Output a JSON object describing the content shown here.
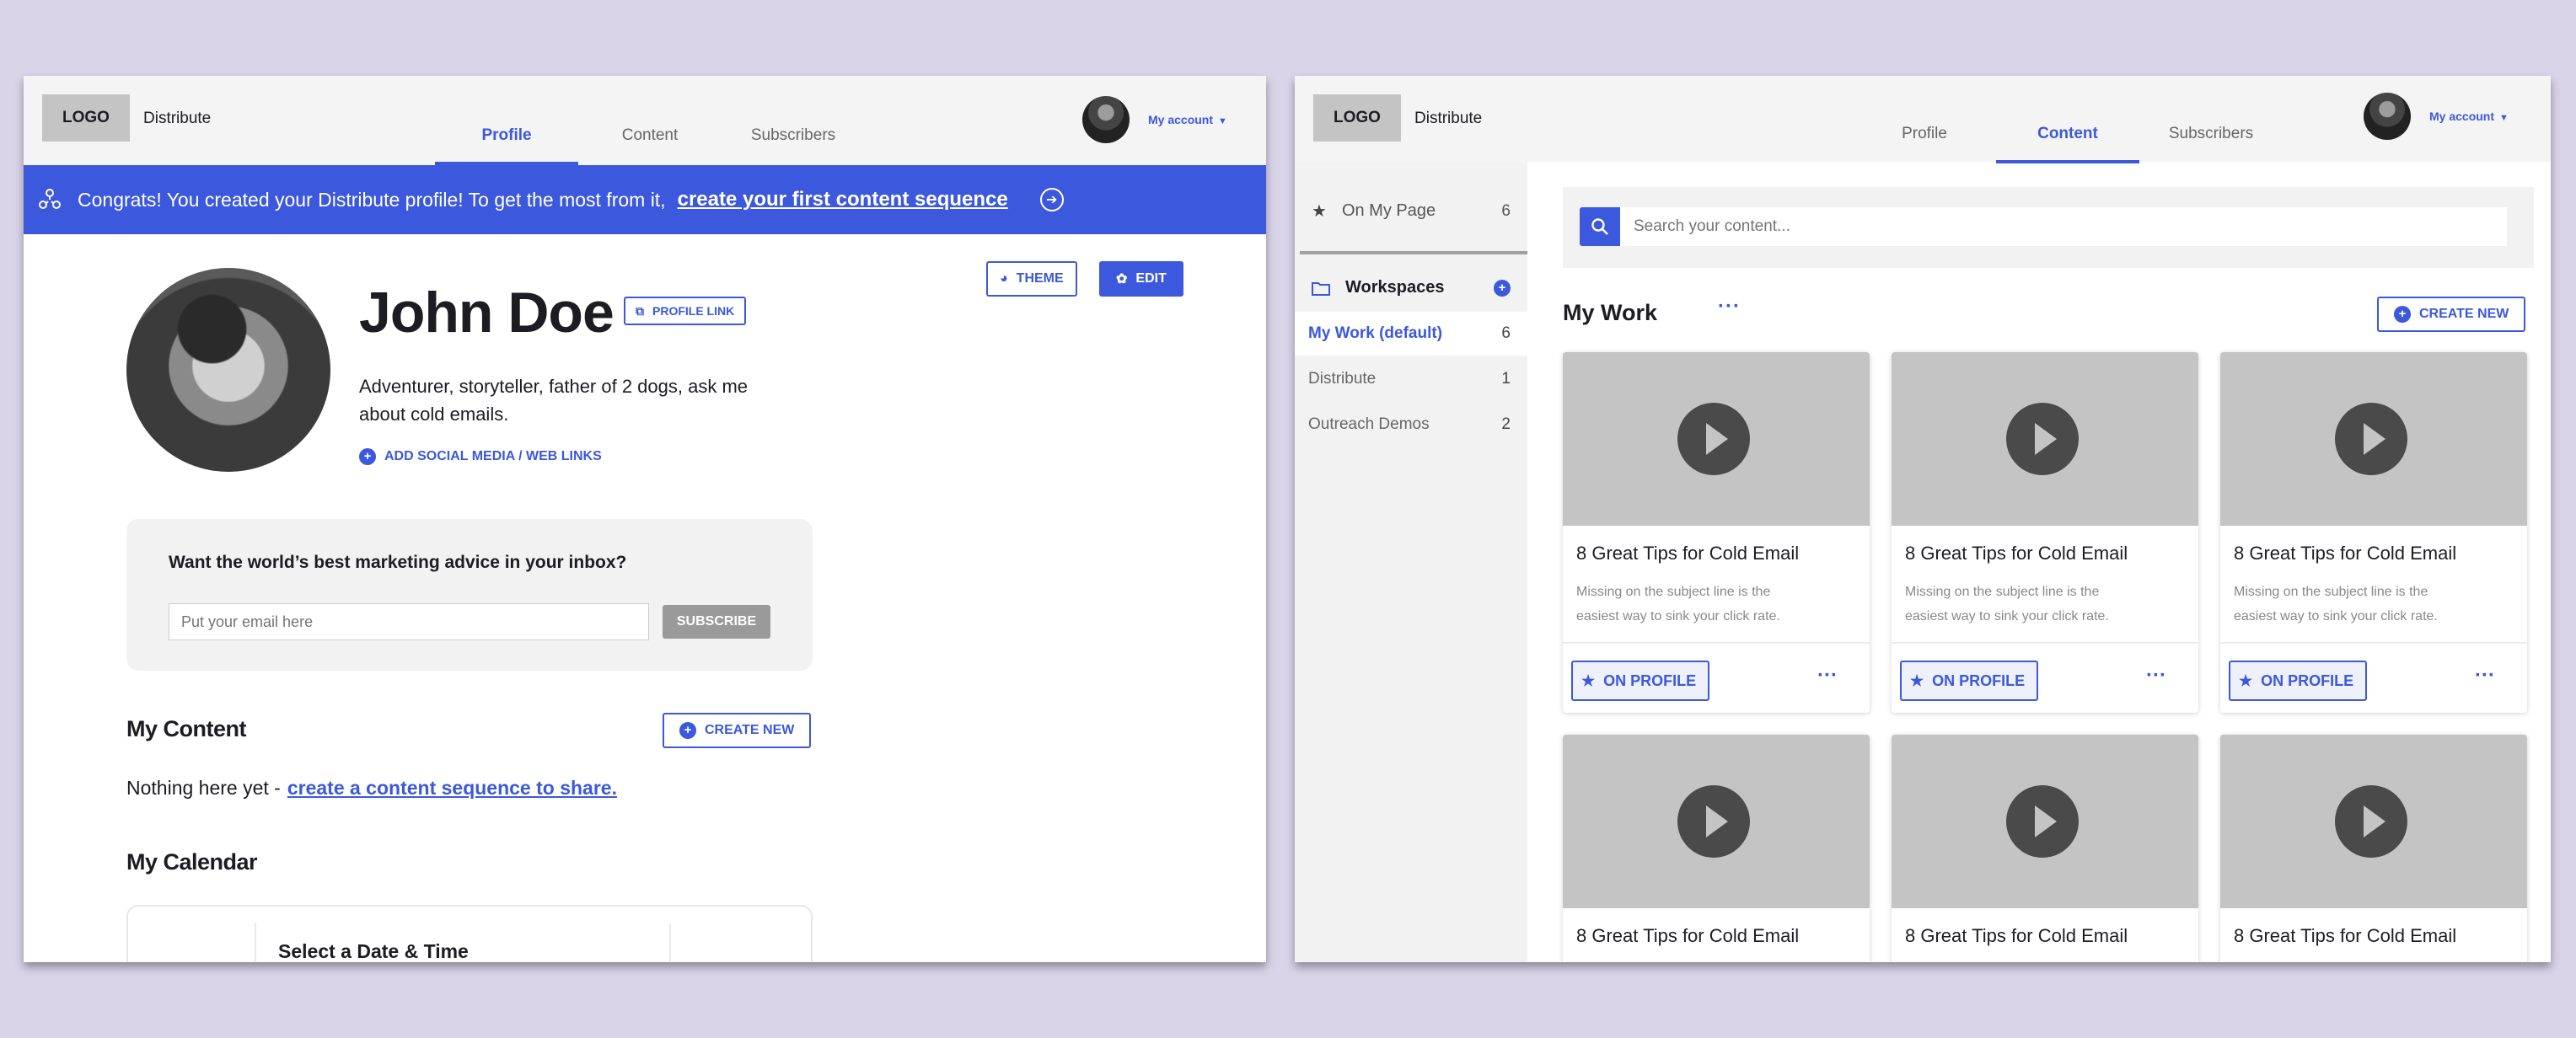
{
  "left_window": {
    "logo": "LOGO",
    "brand": "Distribute",
    "tabs": [
      {
        "label": "Profile"
      },
      {
        "label": "Content"
      },
      {
        "label": "Subscribers"
      }
    ],
    "account_label": "My account",
    "banner": {
      "text": "Congrats! You created your Distribute profile! To get the most from it,",
      "link": "create your first content sequence"
    },
    "profile": {
      "name": "John Doe",
      "profile_link_label": "PROFILE LINK",
      "theme_label": "THEME",
      "edit_label": "EDIT",
      "bio": "Adventurer, storyteller, father of 2 dogs, ask me about cold emails.",
      "add_links_label": "ADD SOCIAL MEDIA / WEB LINKS"
    },
    "newsletter": {
      "heading": "Want the world’s best marketing advice in your inbox?",
      "email_placeholder": "Put your email here",
      "subscribe_label": "SUBSCRIBE"
    },
    "my_content": {
      "heading": "My Content",
      "create_label": "CREATE NEW",
      "empty_text": "Nothing here yet -",
      "empty_link": "create a content sequence to share."
    },
    "my_calendar": {
      "heading": "My Calendar",
      "widget_title": "Select a Date & Time"
    }
  },
  "right_window": {
    "logo": "LOGO",
    "brand": "Distribute",
    "tabs": [
      {
        "label": "Profile"
      },
      {
        "label": "Content"
      },
      {
        "label": "Subscribers"
      }
    ],
    "account_label": "My account",
    "sidebar": {
      "on_my_page": {
        "label": "On My Page",
        "count": "6"
      },
      "workspaces_label": "Workspaces",
      "workspaces": [
        {
          "label": "My Work (default)",
          "count": "6"
        },
        {
          "label": "Distribute",
          "count": "1"
        },
        {
          "label": "Outreach Demos",
          "count": "2"
        }
      ]
    },
    "search_placeholder": "Search your content...",
    "section_title": "My Work",
    "create_label": "CREATE NEW",
    "cards": [
      {
        "title": "8 Great Tips for Cold Email",
        "desc": "Missing on the subject line is the easiest way to sink your click rate.",
        "badge": "ON PROFILE"
      },
      {
        "title": "8 Great Tips for Cold Email",
        "desc": "Missing on the subject line is the easiest way to sink your click rate.",
        "badge": "ON PROFILE"
      },
      {
        "title": "8 Great Tips for Cold Email",
        "desc": "Missing on the subject line is the easiest way to sink your click rate.",
        "badge": "ON PROFILE"
      },
      {
        "title": "8 Great Tips for Cold Email"
      },
      {
        "title": "8 Great Tips for Cold Email"
      },
      {
        "title": "8 Great Tips for Cold Email"
      }
    ]
  },
  "colors": {
    "accent": "#3c58dc",
    "background": "#d9d4e8",
    "placeholder_gray": "#c4c4c4"
  }
}
